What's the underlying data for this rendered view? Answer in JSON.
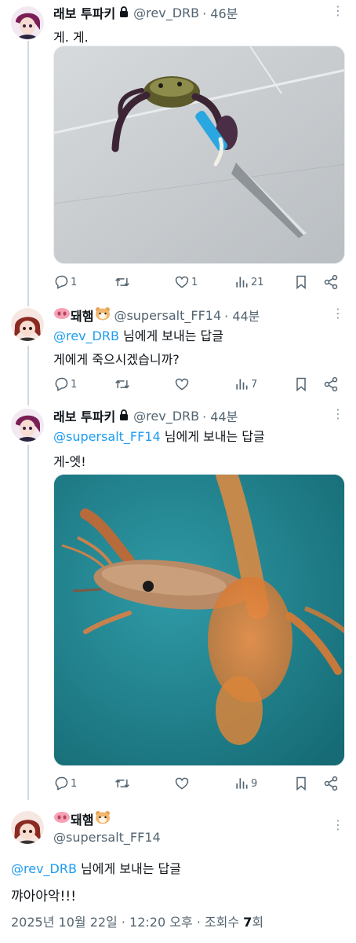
{
  "tweets": [
    {
      "name": "래보 투파키",
      "handle": "@rev_DRB",
      "time": "· 46분",
      "text": "게. 게.",
      "replies": "1",
      "retweets": "",
      "likes": "1",
      "views": "21"
    },
    {
      "name": "돼햄",
      "handle": "@supersalt_FF14",
      "time": "· 44분",
      "reply_mention": "@rev_DRB",
      "reply_suffix": " 님에게 보내는 답글",
      "text": "게에게 죽으시겠습니까?",
      "replies": "1",
      "retweets": "",
      "likes": "",
      "views": "7"
    },
    {
      "name": "래보 투파키",
      "handle": "@rev_DRB",
      "time": "· 44분",
      "reply_mention": "@supersalt_FF14",
      "reply_suffix": " 님에게 보내는 답글",
      "text": "게-엣!",
      "replies": "1",
      "retweets": "",
      "likes": "",
      "views": "9"
    }
  ],
  "main_tweet": {
    "name": "돼햄",
    "handle": "@supersalt_FF14",
    "reply_mention": "@rev_DRB",
    "reply_suffix": " 님에게 보내는 답글",
    "text": "꺄아아악!!!",
    "date": "2025년 10월 22일 · 12:20 오후 · 조회수 ",
    "views": "7",
    "views_suffix": "회"
  },
  "colors": {
    "accent": "#1d9bf0",
    "muted": "#536471",
    "thread_line": "#cfd9de"
  },
  "icons": [
    "lock-icon",
    "more-icon",
    "reply-icon",
    "retweet-icon",
    "like-icon",
    "views-icon",
    "bookmark-icon",
    "share-icon"
  ]
}
